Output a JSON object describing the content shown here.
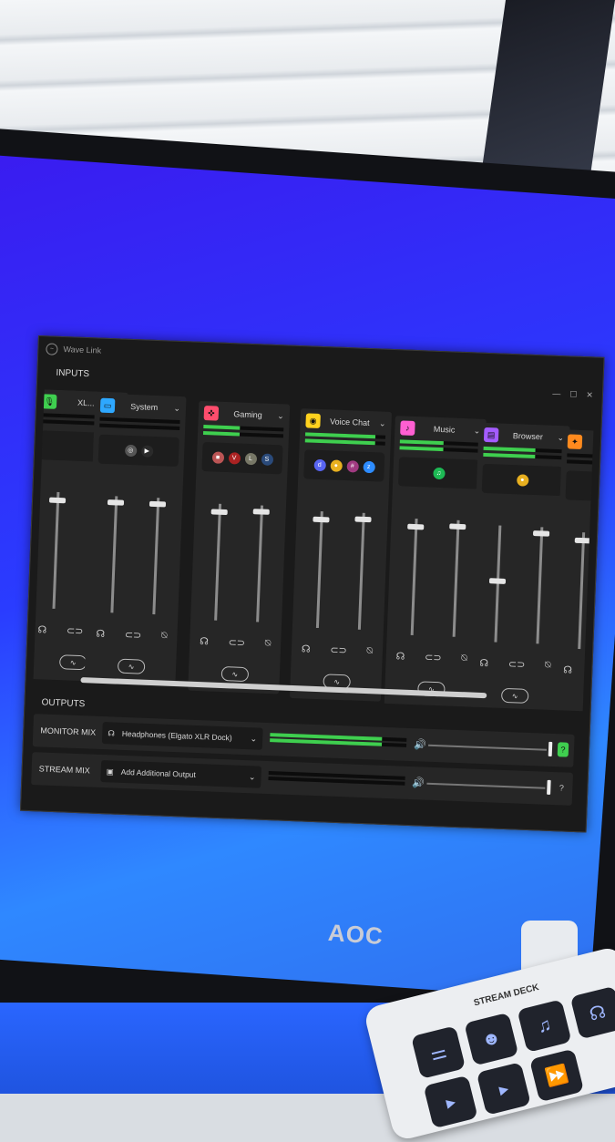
{
  "window": {
    "title": "Wave Link"
  },
  "inputs_label": "INPUTS",
  "outputs_label": "OUTPUTS",
  "channels": [
    {
      "name": "XL...",
      "icon": "microphone-icon",
      "color": "#3fcf4f",
      "level": 0.0,
      "fader": 0.95,
      "apps": []
    },
    {
      "name": "System",
      "icon": "monitor-icon",
      "color": "#2ea8ff",
      "level": 0.0,
      "fader": 0.97,
      "apps": [
        "obs-icon",
        "play-icon"
      ]
    },
    {
      "name": "Gaming",
      "icon": "gamepad-icon",
      "color": "#ff4d6d",
      "level": 0.45,
      "fader": 0.95,
      "apps": [
        "game-app-1-icon",
        "valorant-icon",
        "league-icon",
        "steam-icon"
      ]
    },
    {
      "name": "Voice Chat",
      "icon": "chat-icon",
      "color": "#ffd21e",
      "level": 0.88,
      "fader": 0.95,
      "apps": [
        "discord-icon",
        "chrome-icon",
        "slack-icon",
        "zoom-icon"
      ]
    },
    {
      "name": "Music",
      "icon": "music-icon",
      "color": "#ff5fd2",
      "level": 0.55,
      "fader": 0.95,
      "apps": [
        "spotify-icon"
      ]
    },
    {
      "name": "Browser",
      "icon": "browser-icon",
      "color": "#a45cff",
      "level": 0.65,
      "fader": 0.55,
      "apps": [
        "chrome-icon"
      ]
    },
    {
      "name": "",
      "icon": "sfx-icon",
      "color": "#ff8a1e",
      "level": 0.0,
      "fader": 0.95,
      "apps": []
    }
  ],
  "outputs": [
    {
      "label": "MONITOR MIX",
      "device": "Headphones (Elgato XLR Dock)",
      "level": 0.82,
      "volume": 1.0
    },
    {
      "label": "STREAM MIX",
      "device": "Add Additional Output",
      "level": 0.0,
      "volume": 1.0
    }
  ],
  "monitor": {
    "brand": "AOC"
  },
  "stream_deck": {
    "label": "STREAM DECK"
  }
}
